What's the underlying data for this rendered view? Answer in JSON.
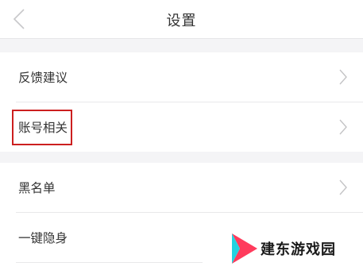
{
  "nav": {
    "title": "设置",
    "back_icon": "chevron-left-icon"
  },
  "settings": {
    "group1": [
      {
        "label": "反馈建议",
        "icon": "chevron-right-icon"
      },
      {
        "label": "账号相关",
        "icon": "chevron-right-icon",
        "highlighted": true
      }
    ],
    "group2": [
      {
        "label": "黑名单",
        "icon": "chevron-right-icon"
      },
      {
        "label": "一键隐身"
      }
    ]
  },
  "watermark": {
    "text": "建东游戏园"
  },
  "colors": {
    "highlight_border": "#cc1f1f",
    "section_gap": "#f4f4f6",
    "divider": "#e8e8ea",
    "chevron": "#c4c4c6",
    "logo_red": "#ff3b5c",
    "logo_cyan": "#22d3e0"
  }
}
